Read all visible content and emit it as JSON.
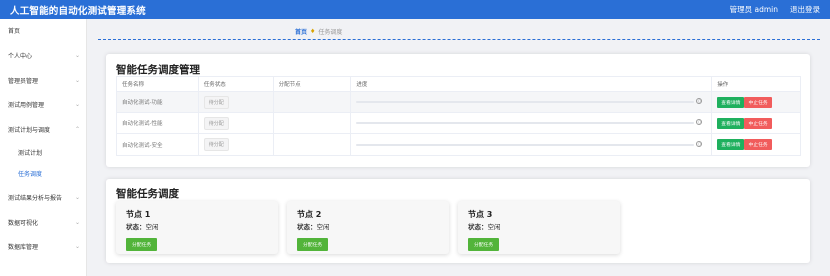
{
  "header": {
    "title": "人工智能的自动化测试管理系统",
    "user": "管理员 admin",
    "logout": "退出登录"
  },
  "sidebar": {
    "items": [
      {
        "label": "首页",
        "chevron": false
      },
      {
        "label": "个人中心",
        "chevron": true
      },
      {
        "label": "管理员管理",
        "chevron": true
      },
      {
        "label": "测试用例管理",
        "chevron": true
      },
      {
        "label": "测试计划与调度",
        "chevron": true
      },
      {
        "label": "测试计划",
        "chevron": false,
        "sub": true
      },
      {
        "label": "任务调度",
        "chevron": false,
        "sub": true,
        "active": true
      },
      {
        "label": "测试结果分析与报告",
        "chevron": true
      },
      {
        "label": "数据可视化",
        "chevron": true
      },
      {
        "label": "数据库管理",
        "chevron": true
      }
    ]
  },
  "breadcrumb": {
    "home": "首页",
    "current": "任务调度"
  },
  "task_panel": {
    "title": "智能任务调度管理",
    "columns": [
      "任务名称",
      "任务状态",
      "分配节点",
      "进度",
      "操作"
    ],
    "rows": [
      {
        "name": "自动化测试-功能",
        "status": "待分配",
        "node": "",
        "progress": 0
      },
      {
        "name": "自动化测试-性能",
        "status": "待分配",
        "node": "",
        "progress": 0
      },
      {
        "name": "自动化测试-安全",
        "status": "待分配",
        "node": "",
        "progress": 0
      }
    ],
    "view_label": "查看详情",
    "stop_label": "中止任务"
  },
  "node_panel": {
    "title": "智能任务调度",
    "status_label": "状态：",
    "assign_label": "分配任务",
    "nodes": [
      {
        "name": "节点 1",
        "status": "空闲"
      },
      {
        "name": "节点 2",
        "status": "空闲"
      },
      {
        "name": "节点 3",
        "status": "空闲"
      }
    ]
  },
  "colors": {
    "primary": "#2a6fd6",
    "success": "#1fb05e",
    "danger": "#f15c5c",
    "assign": "#52b43a"
  }
}
